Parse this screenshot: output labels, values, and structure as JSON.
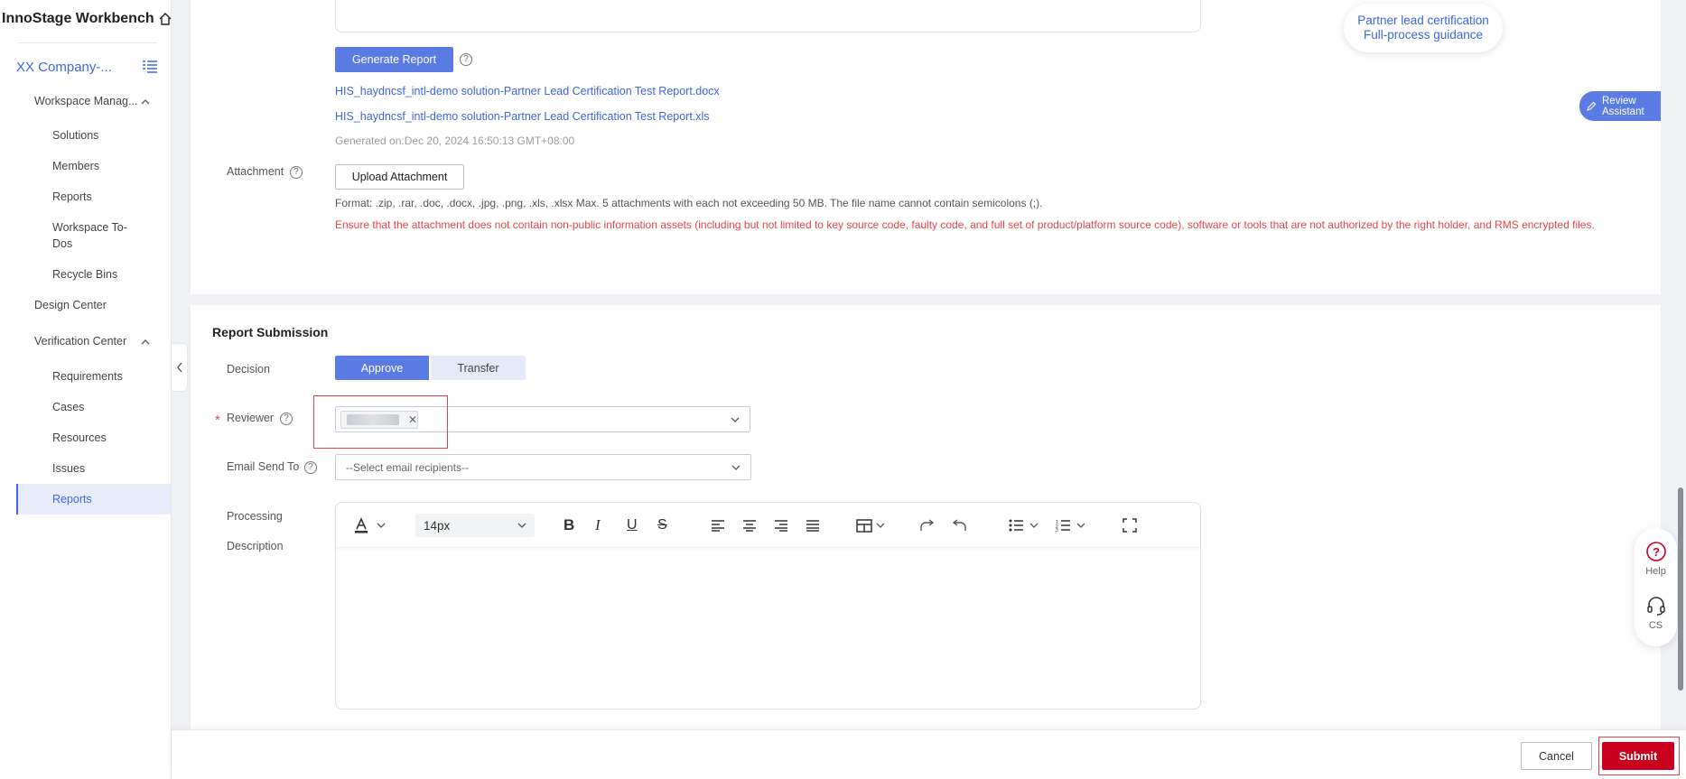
{
  "app": {
    "title": "InnoStage Workbench"
  },
  "sidebar": {
    "company": "XX Company-...",
    "workspace_management": "Workspace Manag...",
    "workspace_items": [
      {
        "label": "Solutions"
      },
      {
        "label": "Members"
      },
      {
        "label": "Reports"
      },
      {
        "label_line1": "Workspace To-",
        "label_line2": "Dos"
      },
      {
        "label": "Recycle Bins"
      }
    ],
    "design_center": "Design Center",
    "verification_center": "Verification Center",
    "verification_items": [
      {
        "label": "Requirements"
      },
      {
        "label": "Cases"
      },
      {
        "label": "Resources"
      },
      {
        "label": "Issues"
      },
      {
        "label": "Reports",
        "active": true
      }
    ]
  },
  "report_section": {
    "generate_button": "Generate Report",
    "files": [
      "HIS_haydncsf_intl-demo solution-Partner Lead Certification Test Report.docx",
      "HIS_haydncsf_intl-demo solution-Partner Lead Certification Test Report.xls"
    ],
    "generated_on": "Generated on:Dec 20, 2024 16:50:13 GMT+08:00",
    "attachment_label": "Attachment",
    "upload_button": "Upload Attachment",
    "format_note": "Format: .zip, .rar, .doc, .docx, .jpg, .png, .xls, .xlsx Max. 5 attachments with each not exceeding 50 MB. The file name cannot contain semicolons (;).",
    "warning": "Ensure that the attachment does not contain non-public information assets (including but not limited to key source code, faulty code, and full set of product/platform source code), software or tools that are not authorized by the right holder, and RMS encrypted files."
  },
  "floating": {
    "cert_line1": "Partner lead certification",
    "cert_line2": "Full-process guidance",
    "review_line1": "Review",
    "review_line2": "Assistant",
    "help": "Help",
    "cs": "CS"
  },
  "submission": {
    "title": "Report Submission",
    "decision_label": "Decision",
    "approve": "Approve",
    "transfer": "Transfer",
    "required_mark": "*",
    "reviewer_label": "Reviewer",
    "email_label": "Email Send To",
    "email_placeholder": "--Select email recipients--",
    "processing_label_line1": "Processing",
    "processing_label_line2": "Description",
    "font_size": "14px"
  },
  "footer": {
    "cancel": "Cancel",
    "submit": "Submit"
  },
  "colors": {
    "primary": "#5b7be4",
    "link": "#3d66e0",
    "danger": "#e0454b",
    "submit": "#c8001e"
  }
}
